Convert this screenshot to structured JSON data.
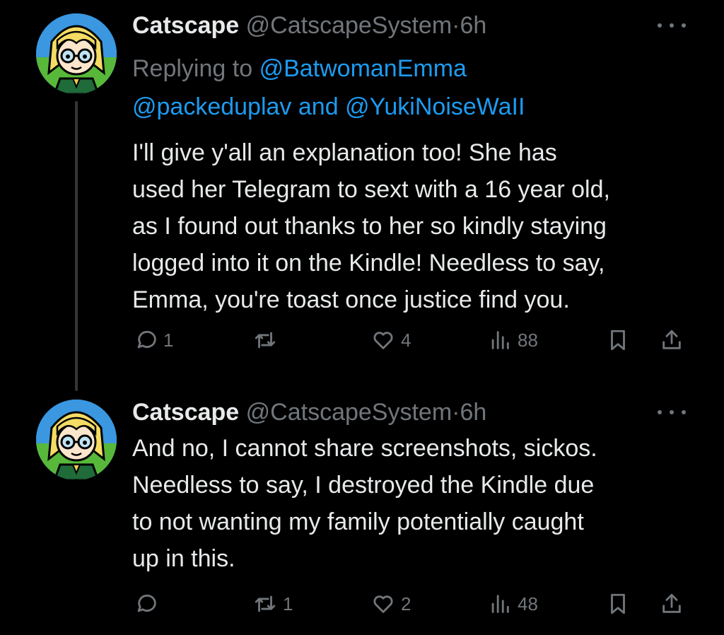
{
  "posts": [
    {
      "display_name": "Catscape",
      "handle": "@CatscapeSystem",
      "separator": "·",
      "time": "6h",
      "replying_prefix": "Replying to",
      "reply_to_1": "@BatwomanEmma",
      "reply_to_2": "@packeduplav",
      "reply_and": "and",
      "reply_to_3": "@YukiNoiseWaII",
      "text_lines": [
        "I'll give y'all an explanation too! She has",
        "used her Telegram to sext with a 16 year old,",
        "as I found out thanks to her so kindly staying",
        "logged into it on the Kindle! Needless to say,",
        "Emma, you're toast once justice find you."
      ],
      "replies": "1",
      "reposts": "",
      "likes": "4",
      "views": "88"
    },
    {
      "display_name": "Catscape",
      "handle": "@CatscapeSystem",
      "separator": "·",
      "time": "6h",
      "text_lines": [
        "And no, I cannot share screenshots, sickos.",
        "Needless to say, I destroyed the Kindle due",
        "to not wanting my family potentially caught",
        "up in this."
      ],
      "replies": "",
      "reposts": "1",
      "likes": "2",
      "views": "48"
    }
  ],
  "icons": {
    "reply": "reply-icon",
    "repost": "repost-icon",
    "like": "heart-icon",
    "views": "views-icon",
    "bookmark": "bookmark-icon",
    "share": "share-icon",
    "more": "more-icon"
  },
  "colors": {
    "background": "#000000",
    "text": "#e7e9ea",
    "secondary": "#71767b",
    "link": "#1d9bf0",
    "thread_line": "#333639"
  }
}
